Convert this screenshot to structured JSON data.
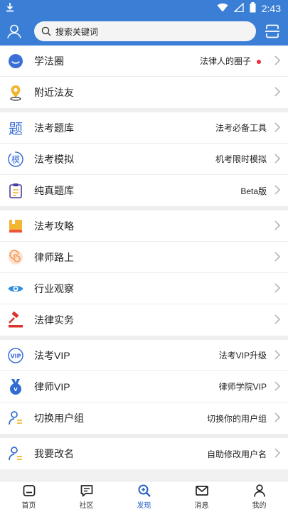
{
  "status_bar": {
    "time": "2:43"
  },
  "header": {
    "search_placeholder": "搜索关键词"
  },
  "groups": [
    [
      {
        "label": "学法圈",
        "sub": "法律人的圈子",
        "dot": true
      },
      {
        "label": "附近法友",
        "sub": ""
      }
    ],
    [
      {
        "label": "法考题库",
        "sub": "法考必备工具"
      },
      {
        "label": "法考模拟",
        "sub": "机考限时模拟"
      },
      {
        "label": "纯真题库",
        "sub": "Beta版"
      }
    ],
    [
      {
        "label": "法考攻略",
        "sub": ""
      },
      {
        "label": "律师路上",
        "sub": ""
      },
      {
        "label": "行业观察",
        "sub": ""
      },
      {
        "label": "法律实务",
        "sub": ""
      }
    ],
    [
      {
        "label": "法考VIP",
        "sub": "法考VIP升级"
      },
      {
        "label": "律师VIP",
        "sub": "律师学院VIP"
      },
      {
        "label": "切换用户组",
        "sub": "切换你的用户组"
      }
    ],
    [
      {
        "label": "我要改名",
        "sub": "自助修改用户名"
      }
    ]
  ],
  "tabs": [
    {
      "label": "首页",
      "icon": "home-icon"
    },
    {
      "label": "社区",
      "icon": "chat-icon"
    },
    {
      "label": "发现",
      "icon": "discover-icon",
      "active": true
    },
    {
      "label": "消息",
      "icon": "mail-icon"
    },
    {
      "label": "我的",
      "icon": "person-icon"
    }
  ],
  "colors": {
    "primary": "#3a7fd5",
    "dot": "#e8303a",
    "tab_active": "#2a62c8"
  }
}
